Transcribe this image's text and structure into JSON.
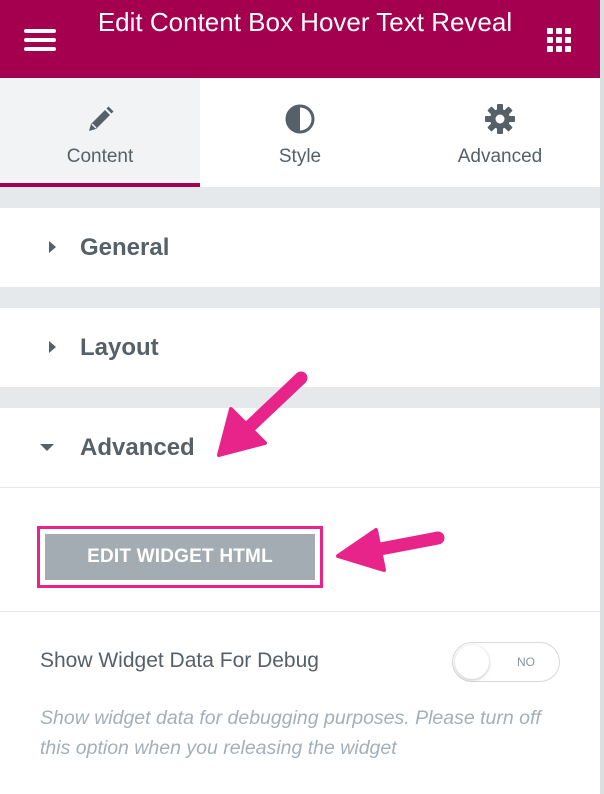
{
  "header": {
    "title": "Edit Content Box Hover Text Reveal",
    "menu_icon": "hamburger-icon",
    "apps_icon": "grid-icon",
    "background": "#a4004f"
  },
  "tabs": [
    {
      "label": "Content",
      "icon": "pencil-icon",
      "active": true
    },
    {
      "label": "Style",
      "icon": "half-circle-icon",
      "active": false
    },
    {
      "label": "Advanced",
      "icon": "gear-icon",
      "active": false
    }
  ],
  "sections": [
    {
      "label": "General",
      "expanded": false
    },
    {
      "label": "Layout",
      "expanded": false
    },
    {
      "label": "Advanced",
      "expanded": true
    }
  ],
  "advanced": {
    "edit_button_label": "EDIT WIDGET HTML",
    "debug_label": "Show Widget Data For Debug",
    "toggle_text": "NO",
    "toggle_on": false,
    "description": "Show widget data for debugging purposes. Please turn off this option when you releasing the widget"
  },
  "annotations": {
    "arrow_color": "#e8248a"
  }
}
